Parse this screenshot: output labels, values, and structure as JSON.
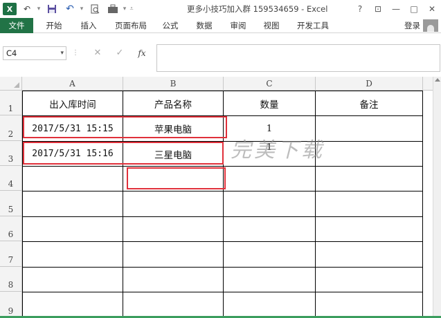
{
  "window": {
    "title": "更多小技巧加入群 159534659 - Excel",
    "app_icon_letter": "X",
    "help": "?",
    "restore": "⊡",
    "minimize": "—",
    "maximize": "□",
    "close": "✕"
  },
  "ribbon": {
    "tabs": [
      "文件",
      "开始",
      "插入",
      "页面布局",
      "公式",
      "数据",
      "审阅",
      "视图",
      "开发工具"
    ],
    "login": "登录"
  },
  "formula_bar": {
    "name_box": "C4",
    "fx_label": "fx",
    "formula": ""
  },
  "sheet": {
    "columns": [
      "A",
      "B",
      "C",
      "D"
    ],
    "rows": [
      "1",
      "2",
      "3",
      "4",
      "5",
      "6",
      "7",
      "8",
      "9"
    ],
    "header": [
      "出入库时间",
      "产品名称",
      "数量",
      "备注"
    ],
    "data": [
      [
        "2017/5/31 15:15",
        "苹果电脑",
        "1",
        ""
      ],
      [
        "2017/5/31 15:16",
        "三星电脑",
        "1",
        ""
      ]
    ]
  },
  "watermark": "完美下载",
  "colors": {
    "excel_green": "#217346",
    "highlight_red": "#e0303a"
  }
}
